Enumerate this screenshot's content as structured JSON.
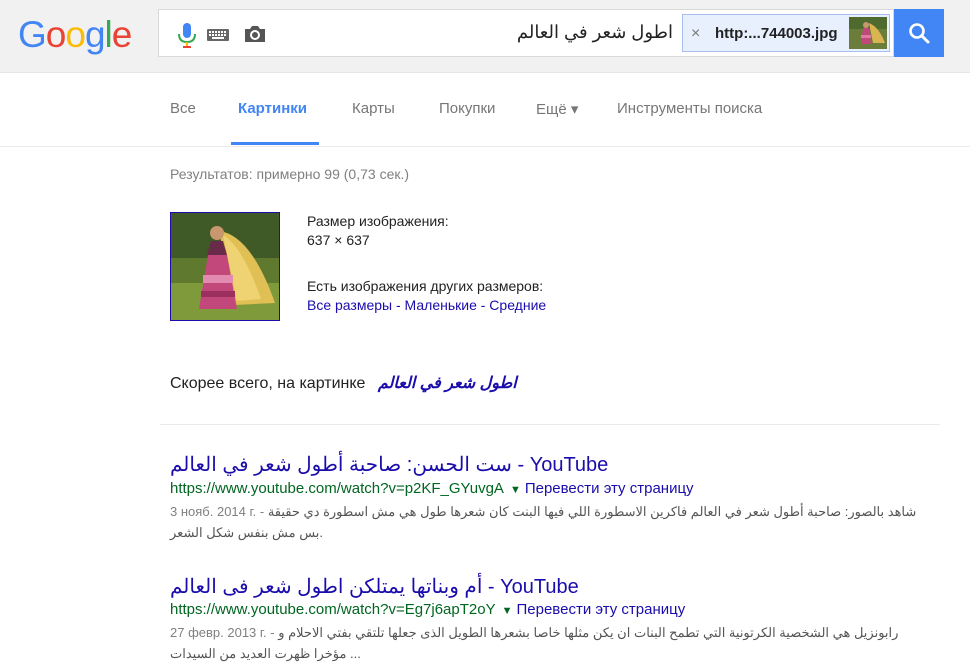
{
  "header": {
    "logo": [
      "G",
      "o",
      "o",
      "g",
      "l",
      "e"
    ],
    "logo_colors": [
      "#4285f4",
      "#ea4335",
      "#fbbc05",
      "#4285f4",
      "#34a853",
      "#ea4335"
    ],
    "query": "اطول شعر في العالم",
    "image_chip_text": "http:...744003.jpg",
    "image_chip_remove": "×"
  },
  "tabs": [
    {
      "label": "Все"
    },
    {
      "label": "Картинки",
      "active": true
    },
    {
      "label": "Карты"
    },
    {
      "label": "Покупки"
    },
    {
      "label": "Ещё ▾"
    },
    {
      "label": "Инструменты поиска"
    }
  ],
  "stats": "Результатов: примерно 99 (0,73 сек.)",
  "image_info": {
    "size_label": "Размер изображения:",
    "size_value": "637 × 637",
    "other_sizes_label": "Есть изображения других размеров:",
    "size_links": "Все размеры - Маленькие - Средние"
  },
  "best_guess": {
    "label": "Скорее всего, на картинке",
    "value": "اطول شعر في العالم"
  },
  "results": [
    {
      "title": "ست الحسن: صاحبة أطول شعر في العالم - YouTube",
      "url": "https://www.youtube.com/watch?v=p2KF_GYuvgA",
      "translate": "Перевести эту страницу",
      "date": "3 нояб. 2014 г. -",
      "snippet": "شاهد بالصور: صاحبة أطول شعر في العالم فاكرين الاسطورة اللي فيها البنت كان شعرها طول هي مش اسطورة دي حقيقة بس مش بنفس شكل الشعر."
    },
    {
      "title": "أم وبناتها يمتلكن اطول شعر فى العالم - YouTube",
      "url": "https://www.youtube.com/watch?v=Eg7j6apT2oY",
      "translate": "Перевести эту страницу",
      "date": "27 февр. 2013 г. -",
      "snippet": "رابونزيل هي الشخصية الكرتونية التي تطمح البنات ان يكن مثلها خاصا بشعرها الطويل الذى جعلها تلتقي بفتي الاحلام و مؤخرا ظهرت العديد من السيدات ..."
    }
  ]
}
